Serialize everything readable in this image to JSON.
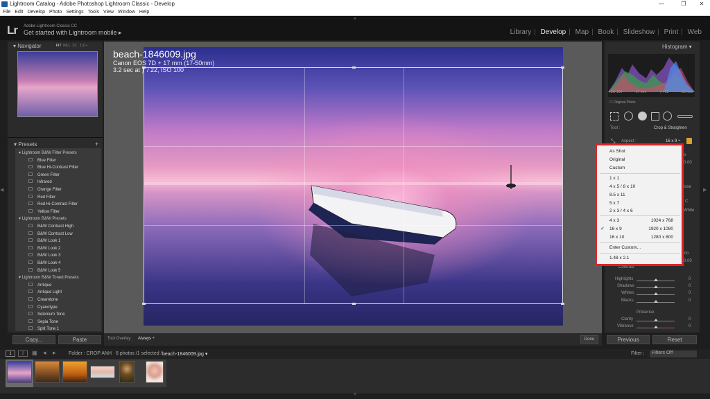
{
  "window": {
    "title": "Lightroom Catalog - Adobe Photoshop Lightroom Classic - Develop",
    "min": "—",
    "max": "❐",
    "close": "✕"
  },
  "menu": [
    "File",
    "Edit",
    "Develop",
    "Photo",
    "Settings",
    "Tools",
    "View",
    "Window",
    "Help"
  ],
  "identity": {
    "logo": "Lr",
    "product": "Adobe Lightroom Classic CC",
    "mobile": "Get started with Lightroom mobile ▸"
  },
  "modules": [
    "Library",
    "Develop",
    "Map",
    "Book",
    "Slideshow",
    "Print",
    "Web"
  ],
  "navigator": {
    "title": "Navigator",
    "fit": "FIT",
    "fill": "FILL",
    "one": "1:1",
    "ratio": "1:2 ÷"
  },
  "presets": {
    "title": "Presets",
    "add": "+",
    "groups": [
      {
        "name": "Lightroom B&W Filter Presets",
        "items": [
          "Blue Filter",
          "Blue Hi-Contrast Filter",
          "Green Filter",
          "Infrared",
          "Orange Filter",
          "Red Filter",
          "Red Hi-Contrast Filter",
          "Yellow Filter"
        ]
      },
      {
        "name": "Lightroom B&W Presets",
        "items": [
          "B&W Contrast High",
          "B&W Contrast Low",
          "B&W Look 1",
          "B&W Look 2",
          "B&W Look 3",
          "B&W Look 4",
          "B&W Look 5"
        ]
      },
      {
        "name": "Lightroom B&W Toned Presets",
        "items": [
          "Antique",
          "Antique Light",
          "Creamtone",
          "Cyanotype",
          "Selenium Tone",
          "Sepia Tone",
          "Split Tone 1"
        ]
      }
    ]
  },
  "left_buttons": {
    "copy": "Copy...",
    "paste": "Paste"
  },
  "photo": {
    "name": "beach-1846009.jpg",
    "camera": "Canon EOS 7D + 17 mm (17-50mm)",
    "exposure": "3.2 sec at ƒ / 22, ISO 100"
  },
  "histogram": {
    "title": "Histogram",
    "iso": "ISO 100",
    "focal": "17 mm",
    "aperture": "ƒ / 22",
    "shutter": "3.2 sec",
    "original": "Original Photo"
  },
  "crop": {
    "tool_label": "Tool :",
    "tool_name": "Crop & Straighten",
    "aspect_label": "Aspect :",
    "aspect_value": "16 x 9 ÷",
    "angle_value": "0.00",
    "close": "lose",
    "tone_peek": "ito",
    "white_peek": "White",
    "val_000": "0.00"
  },
  "aspect_menu": {
    "items_top": [
      "As Shot",
      "Original",
      "Custom"
    ],
    "items_ratio": [
      "1 x 1",
      "4 x 5  /  8 x 10",
      "8.5 x 11",
      "5 x 7",
      "2 x 3  /  4 x 6"
    ],
    "items_screen": [
      {
        "label": "4 x 3",
        "res": "1024 x 768",
        "checked": false
      },
      {
        "label": "16 x 9",
        "res": "1920 x 1080",
        "checked": true
      },
      {
        "label": "16 x 10",
        "res": "1280 x 800",
        "checked": false
      }
    ],
    "enter_custom": "Enter Custom...",
    "custom_value": "1.48 x 2.1",
    "check": "✔"
  },
  "basic": {
    "contrast": "Contrast",
    "highlights": "Highlights",
    "shadows": "Shadows",
    "whites": "Whites",
    "blacks": "Blacks",
    "presence": "Presence",
    "clarity": "Clarity",
    "vibrance": "Vibrance",
    "zero": "0"
  },
  "right_buttons": {
    "previous": "Previous",
    "reset": "Reset"
  },
  "toolbar": {
    "overlay_label": "Tool Overlay :",
    "overlay_value": "Always ÷",
    "done": "Done"
  },
  "filmstrip": {
    "page1": "1",
    "page2": "2",
    "folder": "Folder : CROP ANH",
    "count": "6 photos /1 selected /",
    "file": "beach-1846009.jpg ▾",
    "filter_label": "Filter :",
    "filter_value": "Filters Off"
  },
  "colors": {
    "accent_red": "#e0232a",
    "check_blue": "#2f7fd6"
  }
}
